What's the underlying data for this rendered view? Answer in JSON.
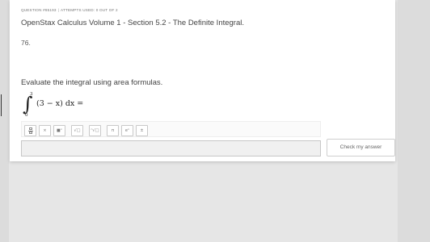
{
  "question": {
    "meta_label": "QUESTION #85193",
    "attempts_label": "ATTEMPTS USED: 0 OUT OF 2",
    "title": "OpenStax Calculus Volume 1 - Section 5.2 - The Definite Integral.",
    "number": "76.",
    "instruction": "Evaluate the integral using area formulas.",
    "math": {
      "upper_limit": "3",
      "lower_limit": "0",
      "integrand": "(3 − x) dx ="
    }
  },
  "toolbar": {
    "buttons": [
      {
        "icon": "fraction-icon",
        "glyph": ""
      },
      {
        "icon": "multiply-icon",
        "glyph": "×"
      },
      {
        "icon": "superscript-icon",
        "glyph": "■ˣ"
      },
      {
        "icon": "square-root-icon",
        "glyph": "√□"
      },
      {
        "icon": "nth-root-icon",
        "glyph": "ⁿ√□"
      },
      {
        "icon": "pi-icon",
        "glyph": "π"
      },
      {
        "icon": "power-of-e-icon",
        "glyph": "eˣ"
      },
      {
        "icon": "plus-minus-icon",
        "glyph": "±"
      }
    ]
  },
  "answer": {
    "value": ""
  },
  "actions": {
    "check_label": "Check my answer"
  }
}
